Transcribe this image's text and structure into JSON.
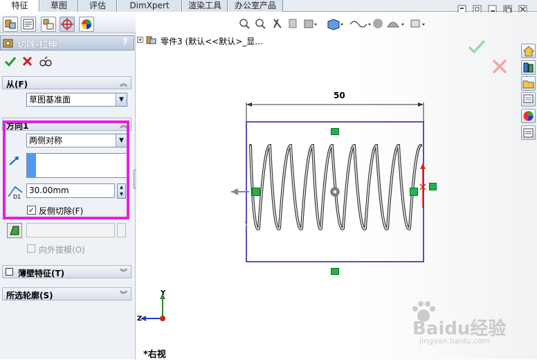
{
  "tabs": [
    {
      "label": "特征",
      "active": true
    },
    {
      "label": "草图",
      "active": false
    },
    {
      "label": "评估",
      "active": false
    },
    {
      "label": "DimXpert",
      "active": false
    },
    {
      "label": "渲染工具",
      "active": false
    },
    {
      "label": "办公室产品",
      "active": false
    }
  ],
  "feature": {
    "title": "切除-拉伸",
    "help": "?",
    "from_section": {
      "title": "从(F)",
      "value": "草图基准面"
    },
    "direction_section": {
      "title": "方向1",
      "end_condition": "两侧对称",
      "depth": "30.00mm",
      "depth_label": "D1",
      "flip_side_label": "反侧切除(F)",
      "flip_side_checked": true,
      "draft_label": "向外拔模(O)",
      "draft_checked": false
    },
    "thin_feature": {
      "title": "薄壁特征(T)",
      "checked": false
    },
    "selected_contours": {
      "title": "所选轮廓(S)"
    }
  },
  "tree": {
    "label": "零件3   (默认<<默认>_显..."
  },
  "dimension": {
    "value": "50"
  },
  "view": {
    "label": "*右视",
    "axis_z": "Z",
    "axis_y": "Y"
  },
  "watermark": {
    "brand": "Baidu经验",
    "url": "jingyan.baidu.com"
  },
  "colors": {
    "highlight": "#e91ee0",
    "handle": "#22b24c",
    "sketch": "#1a1a9e",
    "accept": "#1a9e2c",
    "cancel": "#c61d1d"
  }
}
